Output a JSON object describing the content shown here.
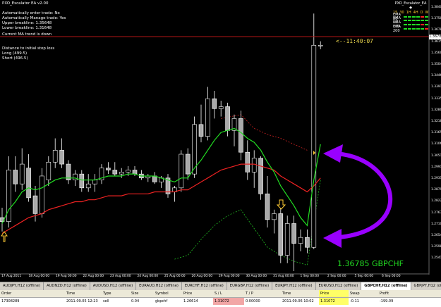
{
  "ea": {
    "title": "PXO_Escalator EA v2.00",
    "lines": [
      "Automatically enter trade: No",
      "Automatically Manage trade: Yes",
      "Upper breakline: 1.35648",
      "Lower breakline: 1.31648"
    ],
    "trend": "Current MA trend is down",
    "stop_title": "Distance to initial stop loss",
    "stop_long": "Long  (499.5)",
    "stop_short": "Short (496.5)"
  },
  "legend": {
    "title": "PXO_Escalator_EA ◆",
    "timeframes": [
      "15",
      "30",
      "1H",
      "4H",
      "D",
      "W"
    ],
    "emas": [
      {
        "label": "EMA 20",
        "colors": [
          "#22dd22",
          "#22dd22",
          "#22dd22",
          "#22dd22",
          "#ff2222",
          "#22dd22"
        ]
      },
      {
        "label": "EMA 50",
        "colors": [
          "#22dd22",
          "#22dd22",
          "#22dd22",
          "#22dd22",
          "#22dd22",
          "#22dd22"
        ]
      },
      {
        "label": "EMA 100",
        "colors": [
          "#22dd22",
          "#22dd22",
          "#22dd22",
          "#22dd22",
          "#ff2222",
          "#22dd22"
        ]
      },
      {
        "label": "EMA 200",
        "colors": [
          "#22dd22",
          "#22dd22",
          "#22dd22",
          "#22dd22",
          "#22dd22",
          "#ff2222"
        ]
      }
    ]
  },
  "price_tag": "1.36785",
  "timer": "<--11:40:07",
  "quote": "1.36785  GBPCHF",
  "y_axis": [
    "1.38405",
    "1.37505",
    "1.36785",
    "1.36155",
    "1.35600",
    "1.35040",
    "1.34460",
    "1.33910",
    "1.33350",
    "1.32800",
    "1.32180",
    "1.31655",
    "1.31060",
    "1.30510",
    "1.29915",
    "1.29355",
    "1.28790",
    "1.28225",
    "1.27670",
    "1.27105",
    "1.26545",
    "1.25980",
    "1.25415"
  ],
  "x_axis": [
    "17 Aug 2011",
    "18 Aug 00:00",
    "19 Aug 00:00",
    "22 Aug 00:00",
    "23 Aug 00:00",
    "24 Aug 00:00",
    "25 Aug 00:00",
    "26 Aug 00:00",
    "29 Aug 00:00",
    "30 Aug 00:00",
    "31 Aug 00:00",
    "1 Sep 00:00",
    "2 Sep 00:00",
    "5 Sep 00:00",
    "6 Sep 00:00"
  ],
  "tabs": [
    "AUDJPY,H12 (offline)",
    "AUDNZD,H12 (offline)",
    "AUDUSD,H12 (offline)",
    "EURAUD,H12 (offline)",
    "EURCHF,H12 (offline)",
    "EURGBP,H12 (offline)",
    "EURJPY,H12 (offline)",
    "EURUSD,H12 (offline)",
    "GBPCHF,H12 (offline)",
    "GBPJPY,H12 (off"
  ],
  "active_tab": 8,
  "terminal": {
    "headers": [
      "Order",
      "Time",
      "Type",
      "Size",
      "Symbol",
      "Price",
      "S / L",
      "T / P",
      "Time",
      "Price",
      "Swap",
      "Profit"
    ],
    "row": [
      "17308289",
      "2011.09.05 12:23",
      "sell",
      "0.04",
      "gbpchf",
      "1.26614",
      "1.31072",
      "0.00000",
      "2011.09.06 10:02",
      "1.31072",
      "-0.11",
      "-199.09"
    ]
  },
  "colors": {
    "ema_fast": "#22dd22",
    "ema_slow": "#ee2222",
    "stop_upper": "#cc2222",
    "stop_lower": "#22bb22",
    "annotation": "#9900ff",
    "candle_bull": "#ffffff",
    "candle_bear": "#aaaaaa",
    "arrow": "#ffcc33"
  },
  "chart_data": {
    "type": "candlestick",
    "symbol": "GBPCHF",
    "timeframe": "H12",
    "ylim": [
      1.254,
      1.388
    ],
    "candles": [
      [
        1.281,
        1.286,
        1.274,
        1.279
      ],
      [
        1.279,
        1.312,
        1.276,
        1.305
      ],
      [
        1.305,
        1.312,
        1.294,
        1.298
      ],
      [
        1.298,
        1.316,
        1.295,
        1.308
      ],
      [
        1.306,
        1.313,
        1.289,
        1.291
      ],
      [
        1.292,
        1.297,
        1.279,
        1.283
      ],
      [
        1.283,
        1.306,
        1.281,
        1.302
      ],
      [
        1.3,
        1.312,
        1.297,
        1.309
      ],
      [
        1.309,
        1.321,
        1.306,
        1.315
      ],
      [
        1.315,
        1.321,
        1.306,
        1.308
      ],
      [
        1.308,
        1.31,
        1.298,
        1.3
      ],
      [
        1.3,
        1.305,
        1.297,
        1.303
      ],
      [
        1.303,
        1.305,
        1.294,
        1.296
      ],
      [
        1.296,
        1.303,
        1.294,
        1.298
      ],
      [
        1.298,
        1.303,
        1.294,
        1.3
      ],
      [
        1.3,
        1.308,
        1.298,
        1.306
      ],
      [
        1.306,
        1.309,
        1.303,
        1.305
      ],
      [
        1.305,
        1.309,
        1.302,
        1.303
      ],
      [
        1.303,
        1.306,
        1.301,
        1.304
      ],
      [
        1.304,
        1.307,
        1.302,
        1.305
      ],
      [
        1.305,
        1.307,
        1.302,
        1.303
      ],
      [
        1.303,
        1.305,
        1.3,
        1.301
      ],
      [
        1.301,
        1.303,
        1.299,
        1.302
      ],
      [
        1.302,
        1.304,
        1.298,
        1.299
      ],
      [
        1.299,
        1.302,
        1.296,
        1.301
      ],
      [
        1.301,
        1.303,
        1.291,
        1.293
      ],
      [
        1.294,
        1.297,
        1.289,
        1.296
      ],
      [
        1.296,
        1.315,
        1.294,
        1.313
      ],
      [
        1.313,
        1.316,
        1.3,
        1.303
      ],
      [
        1.303,
        1.332,
        1.301,
        1.328
      ],
      [
        1.328,
        1.338,
        1.319,
        1.322
      ],
      [
        1.322,
        1.347,
        1.32,
        1.341
      ],
      [
        1.341,
        1.345,
        1.331,
        1.336
      ],
      [
        1.336,
        1.34,
        1.332,
        1.337
      ],
      [
        1.337,
        1.339,
        1.322,
        1.325
      ],
      [
        1.325,
        1.333,
        1.317,
        1.331
      ],
      [
        1.331,
        1.335,
        1.31,
        1.314
      ],
      [
        1.314,
        1.32,
        1.3,
        1.304
      ],
      [
        1.304,
        1.315,
        1.296,
        1.311
      ],
      [
        1.311,
        1.312,
        1.29,
        1.293
      ],
      [
        1.293,
        1.302,
        1.276,
        1.28
      ],
      [
        1.28,
        1.285,
        1.273,
        1.283
      ],
      [
        1.283,
        1.286,
        1.258,
        1.262
      ],
      [
        1.262,
        1.282,
        1.258,
        1.278
      ],
      [
        1.278,
        1.282,
        1.254,
        1.268
      ],
      [
        1.268,
        1.275,
        1.264,
        1.271
      ],
      [
        1.271,
        1.275,
        1.263,
        1.266
      ],
      [
        1.266,
        1.384,
        1.265,
        1.368
      ],
      [
        1.368,
        1.37,
        1.366,
        1.368
      ]
    ],
    "ema_fast": [
      1.278,
      1.285,
      1.289,
      1.294,
      1.296,
      1.295,
      1.296,
      1.298,
      1.3,
      1.301,
      1.301,
      1.301,
      1.3,
      1.3,
      1.3,
      1.301,
      1.302,
      1.302,
      1.302,
      1.303,
      1.303,
      1.302,
      1.302,
      1.302,
      1.301,
      1.3,
      1.299,
      1.301,
      1.301,
      1.306,
      1.31,
      1.315,
      1.32,
      1.324,
      1.325,
      1.326,
      1.324,
      1.321,
      1.319,
      1.315,
      1.309,
      1.304,
      1.297,
      1.292,
      1.287,
      1.281,
      1.277,
      1.3,
      1.318
    ],
    "ema_slow": [
      1.273,
      1.275,
      1.277,
      1.279,
      1.281,
      1.282,
      1.283,
      1.285,
      1.286,
      1.287,
      1.288,
      1.289,
      1.289,
      1.29,
      1.29,
      1.291,
      1.292,
      1.292,
      1.292,
      1.293,
      1.293,
      1.293,
      1.293,
      1.294,
      1.294,
      1.294,
      1.294,
      1.295,
      1.295,
      1.297,
      1.299,
      1.301,
      1.303,
      1.305,
      1.306,
      1.307,
      1.308,
      1.308,
      1.308,
      1.307,
      1.306,
      1.305,
      1.302,
      1.3,
      1.298,
      1.296,
      1.294,
      1.297,
      1.301
    ],
    "stop_upper": [
      [
        33,
        1.331
      ],
      [
        36,
        1.333
      ],
      [
        38,
        1.326
      ],
      [
        40,
        1.323
      ],
      [
        42,
        1.321
      ],
      [
        44,
        1.318
      ],
      [
        46,
        1.315
      ]
    ],
    "stop_lower": [
      [
        26,
        1.26
      ],
      [
        28,
        1.262
      ],
      [
        30,
        1.27
      ],
      [
        32,
        1.277
      ],
      [
        34,
        1.282
      ],
      [
        36,
        1.285
      ],
      [
        40,
        1.266
      ],
      [
        42,
        1.262
      ],
      [
        44,
        1.259
      ],
      [
        46,
        1.257
      ],
      [
        48,
        1.3
      ]
    ]
  }
}
